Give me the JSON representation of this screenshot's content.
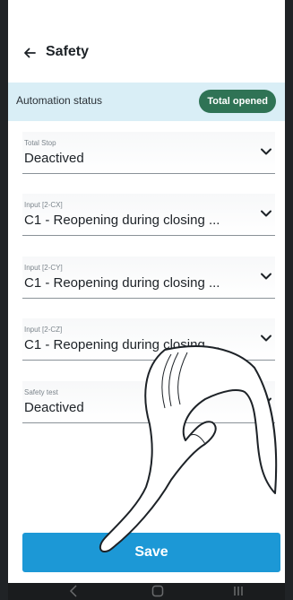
{
  "header": {
    "title": "Safety",
    "back_icon": "arrow-left-icon"
  },
  "status": {
    "label": "Automation status",
    "badge": "Total opened",
    "badge_color": "#2f7355"
  },
  "fields": [
    {
      "label": "Total Stop",
      "value": "Deactived"
    },
    {
      "label": "Input [2-CX]",
      "value": "C1 - Reopening during closing ..."
    },
    {
      "label": "Input [2-CY]",
      "value": "C1 - Reopening during closing ..."
    },
    {
      "label": "Input [2-CZ]",
      "value": "C1 - Reopening during closing ..."
    },
    {
      "label": "Safety test",
      "value": "Deactived"
    }
  ],
  "save_button": {
    "label": "Save",
    "color": "#1c98d6"
  },
  "colors": {
    "status_background": "#d9eef6",
    "nav_background": "#1a1c1e"
  },
  "nav_icons": [
    "back-gesture-icon",
    "home-icon",
    "recents-icon"
  ],
  "overlay": {
    "icon": "pointing-hand-icon"
  }
}
